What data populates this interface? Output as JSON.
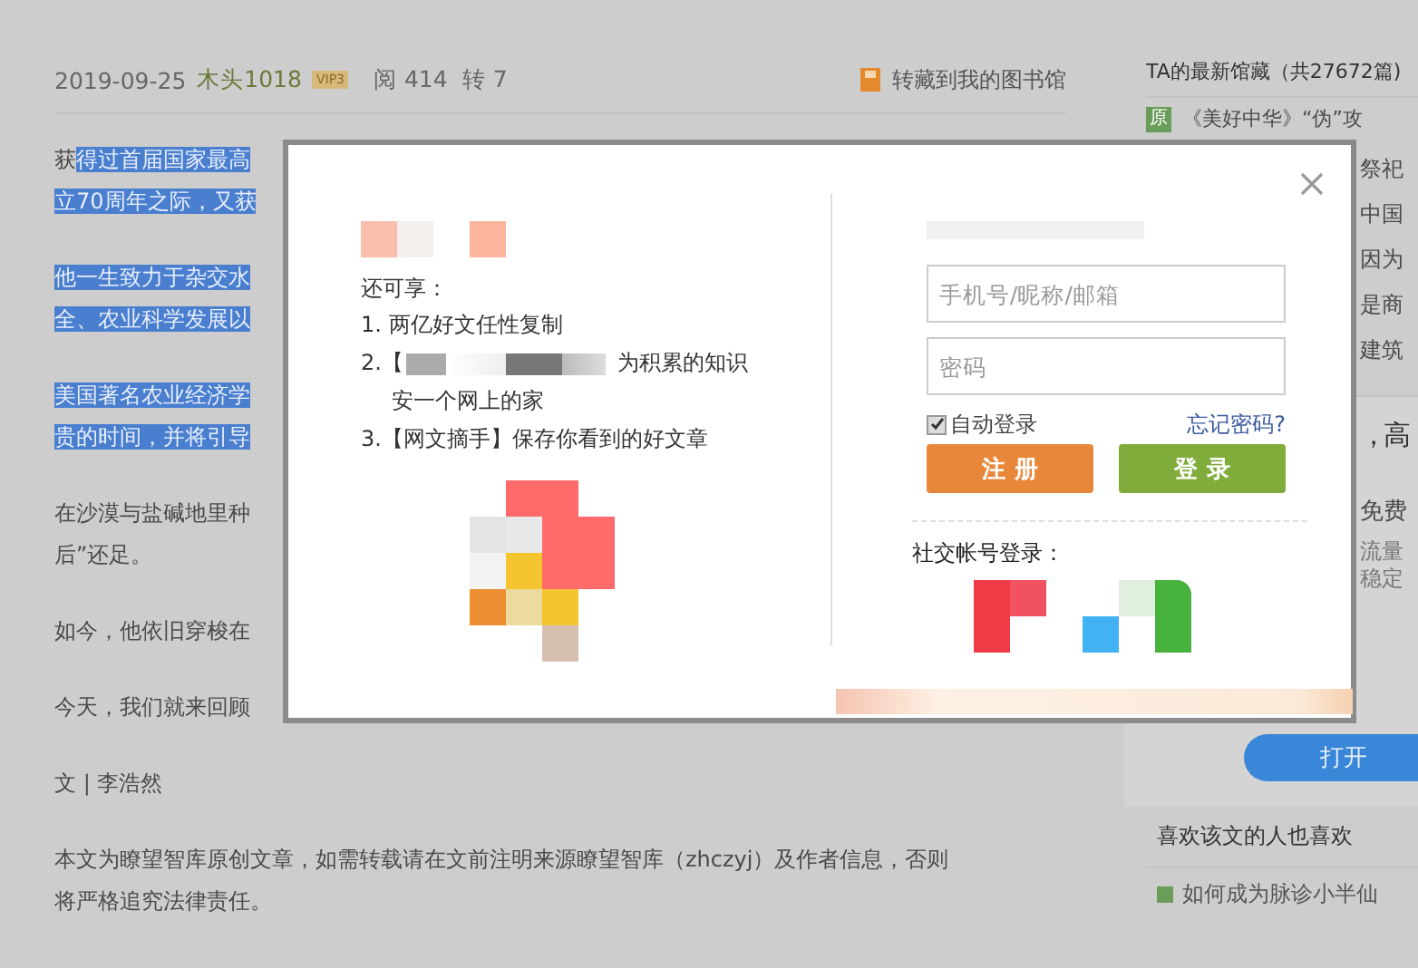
{
  "article": {
    "meta": {
      "date": "2019-09-25",
      "author": "木头1018",
      "level_badge": "VIP3",
      "reads": "阅 414",
      "shares": "转 7",
      "save_link": "转藏到我的图书馆"
    },
    "paragraphs": [
      {
        "lines": [
          [
            {
              "text": "获",
              "highlighted": false
            },
            {
              "text": "得过首届国家最高",
              "highlighted": true
            }
          ],
          [
            {
              "text": "立70周年之际，又获",
              "highlighted": true
            }
          ]
        ]
      },
      {
        "lines": [
          [
            {
              "text": "他一生致力于杂交水",
              "highlighted": true
            }
          ],
          [
            {
              "text": "全、农业科学发展以",
              "highlighted": true
            }
          ]
        ]
      },
      {
        "lines": [
          [
            {
              "text": "美国著名农业经济学",
              "highlighted": true
            }
          ],
          [
            {
              "text": "贵的时间，并将引导",
              "highlighted": true
            }
          ]
        ]
      },
      {
        "lines": [
          [
            {
              "text": "在沙漠与盐碱地里种",
              "highlighted": false
            }
          ],
          [
            {
              "text": "后”还足。",
              "highlighted": false
            }
          ]
        ]
      },
      {
        "lines": [
          [
            {
              "text": "如今，他依旧穿梭在",
              "highlighted": false
            }
          ]
        ]
      },
      {
        "lines": [
          [
            {
              "text": "今天，我们就来回顾",
              "highlighted": false
            }
          ]
        ]
      },
      {
        "lines": [
          [
            {
              "text": "文 | 李浩然",
              "highlighted": false
            }
          ]
        ]
      },
      {
        "lines": [
          [
            {
              "text": "本文为瞭望智库原创文章，如需转载请在文前注明来源瞭望智库（zhczyj）及作者信息，否则",
              "highlighted": false
            }
          ],
          [
            {
              "text": "将严格追究法律责任。",
              "highlighted": false
            }
          ]
        ]
      }
    ]
  },
  "sidebar": {
    "title": "TA的最新馆藏（共27672篇)",
    "featured": {
      "badge": "原",
      "text": "《美好中华》“伪”攻"
    },
    "items": [
      "祭祀",
      "中国",
      "因为",
      "是商",
      "建筑"
    ],
    "ad": {
      "headline": [
        "，高"
      ],
      "lines": [
        "免费"
      ],
      "small_lines": [
        "流量",
        "稳定"
      ],
      "button": "打开"
    },
    "liked_title": "喜欢该文的人也喜欢",
    "liked_items": [
      "如何成为脉诊小半仙"
    ]
  },
  "login_dialog": {
    "benefits_title": "还可享：",
    "benefits": [
      {
        "kind": "text",
        "text": "1. 两亿好文任性复制"
      },
      {
        "kind": "blurred",
        "before": "2.【",
        "after": "为积累的知识",
        "continuation": "安一个网上的家"
      },
      {
        "kind": "text",
        "text": "3.【网文摘手】保存你看到的好文章"
      }
    ],
    "username": {
      "placeholder": "手机号/昵称/邮箱"
    },
    "password": {
      "placeholder": "密码"
    },
    "remember": {
      "label": "自动登录",
      "checked": true
    },
    "forgot_link": "忘记密码?",
    "register_button": "注 册",
    "login_button": "登 录",
    "social_title": "社交帐号登录："
  }
}
